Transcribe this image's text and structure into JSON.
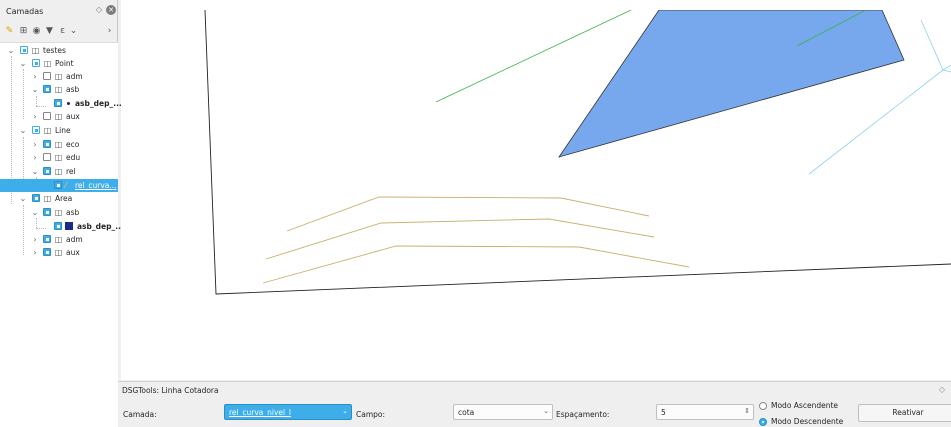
{
  "layers_panel": {
    "title": "Camadas",
    "tree": [
      {
        "label": "testes"
      },
      {
        "label": "Point"
      },
      {
        "label": "adm"
      },
      {
        "label": "asb"
      },
      {
        "label": "asb_dep_..."
      },
      {
        "label": "aux"
      },
      {
        "label": "Line"
      },
      {
        "label": "eco"
      },
      {
        "label": "edu"
      },
      {
        "label": "rel"
      },
      {
        "label": "rel_curva..."
      },
      {
        "label": "Area"
      },
      {
        "label": "asb"
      },
      {
        "label": "asb_dep_..."
      },
      {
        "label": "adm"
      },
      {
        "label": "aux"
      }
    ]
  },
  "dock": {
    "title": "DSGTools: Linha Cotadora",
    "layer_label": "Camada:",
    "layer_value": "rel_curva_nivel_l",
    "field_label": "Campo:",
    "field_value": "cota",
    "spacing_label": "Espaçamento:",
    "spacing_value": "5",
    "ascending_label": "Modo Ascendente",
    "descending_label": "Modo Descendente",
    "reactivate_label": "Reativar"
  },
  "colors": {
    "selection": "#3daee9",
    "polygon_fill": "#77a7ec",
    "contour_line": "#c9b06a",
    "green_line": "#3cb34a",
    "cyan_line": "#8fd3ea"
  }
}
